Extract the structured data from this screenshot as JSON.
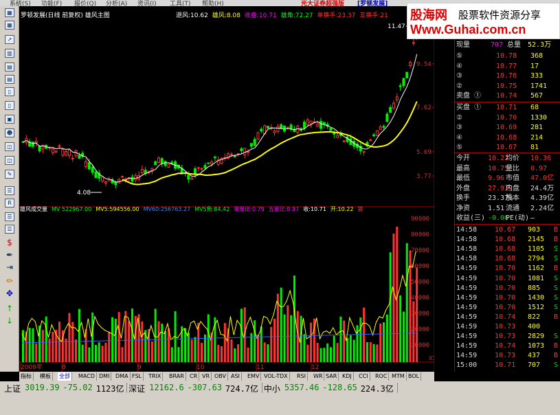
{
  "menu": {
    "items": [
      "系统(S)",
      "功能(F)",
      "报价(Q)",
      "分析(A)",
      "资讯(I)",
      "工具(T)",
      "帮助(H)"
    ],
    "brand": "光大证券超强版",
    "stock_title": "[罗顿发展]"
  },
  "toolbar_icons": [
    "grid-icon",
    "grid-icon",
    "trend-icon",
    "bar-icon",
    "table-icon",
    "table-icon",
    "doc-icon",
    "doc-icon",
    "folder-icon",
    "people-icon",
    "chart-icon",
    "chart-icon",
    "edit-icon",
    "list-icon",
    "rs-icon",
    "list-icon",
    "list-icon",
    "dollar-icon",
    "pen-icon",
    "export-icon",
    "pencil-icon",
    "crosshair-icon",
    "up-arrow-icon",
    "down-arrow-icon"
  ],
  "kline": {
    "title": "罗顿发展(日线 前复权) 雄风主图",
    "indicators": [
      {
        "label": "退风:10.62",
        "color": "#ffffff"
      },
      {
        "label": "雄风:8.08",
        "color": "#ffff00"
      },
      {
        "label": "收盘:10.71",
        "color": "#ff00ff"
      },
      {
        "label": "雄角:72.27",
        "color": "#00ff00"
      },
      {
        "label": "单换手:23.37",
        "color": "#ff3333"
      },
      {
        "label": "五换手:21",
        "color": "#ff3333"
      }
    ],
    "price_labels": [
      "9.54",
      "7.62",
      "5.69",
      "3.77"
    ],
    "high_label": "11.47",
    "low_label": "4.08"
  },
  "volume": {
    "indicators": [
      {
        "label": "雄风成交量",
        "color": "#ffffff"
      },
      {
        "label": "MV 522967.00",
        "color": "#00ff00"
      },
      {
        "label": "MV5:594556.00",
        "color": "#ffff00"
      },
      {
        "label": "MV60:256763.27",
        "color": "#4488ff"
      },
      {
        "label": "MV5角:84.42",
        "color": "#00ff00"
      },
      {
        "label": "单量比:0.79",
        "color": "#ff00ff"
      },
      {
        "label": "五量比:0.97",
        "color": "#ff00ff"
      },
      {
        "label": "收:10.71",
        "color": "#ffffff"
      },
      {
        "label": "开:10.22",
        "color": "#ffff00"
      },
      {
        "label": "震",
        "color": "#ff3333"
      }
    ],
    "axis_labels": [
      "90000",
      "80000",
      "70000",
      "60000",
      "50000",
      "40000",
      "30000",
      "20000",
      "10000"
    ],
    "unit": "X10",
    "months": [
      "2009年",
      "8",
      "9",
      "10",
      "11",
      "12"
    ]
  },
  "quote": {
    "xianliang_label": "现量",
    "xianliang": "707",
    "zongliang_label": "总量",
    "zongliang": "52.3万",
    "sells": [
      {
        "n": "⑤",
        "p": "10.78",
        "v": "368"
      },
      {
        "n": "④",
        "p": "10.77",
        "v": "17"
      },
      {
        "n": "③",
        "p": "10.76",
        "v": "333"
      },
      {
        "n": "②",
        "p": "10.75",
        "v": "1741"
      },
      {
        "n": "卖盘 ①",
        "p": "10.74",
        "v": "567"
      }
    ],
    "buys": [
      {
        "n": "买盘 ①",
        "p": "10.71",
        "v": "68"
      },
      {
        "n": "②",
        "p": "10.70",
        "v": "1330"
      },
      {
        "n": "③",
        "p": "10.69",
        "v": "281"
      },
      {
        "n": "④",
        "p": "10.68",
        "v": "214"
      },
      {
        "n": "⑤",
        "p": "10.67",
        "v": "81"
      }
    ],
    "stats": [
      {
        "l1": "今开",
        "v1": "10.22",
        "l2": "均价",
        "v2": "10.36"
      },
      {
        "l1": "最高",
        "v1": "10.75",
        "l2": "量比",
        "v2": "0.97"
      },
      {
        "l1": "最低",
        "v1": "9.96",
        "l2": "市值",
        "v2": "47.0亿"
      },
      {
        "l1": "外盘",
        "v1": "27.9万",
        "l2": "内盘",
        "v2": "24.4万"
      },
      {
        "l1": "换手",
        "v1": "23.37%",
        "l2": "股本",
        "v2": "4.39亿"
      },
      {
        "l1": "净资",
        "v1": "1.51",
        "l2": "流通",
        "v2": "2.24亿"
      },
      {
        "l1": "收益(三)",
        "v1": "-0.06",
        "l2": "PE(动)",
        "v2": "—"
      }
    ],
    "ticks": [
      {
        "t": "14:58",
        "p": "10.67",
        "v": "903",
        "d": "B"
      },
      {
        "t": "14:58",
        "p": "10.68",
        "v": "2145",
        "d": "B"
      },
      {
        "t": "14:58",
        "p": "10.68",
        "v": "1105",
        "d": "S"
      },
      {
        "t": "14:58",
        "p": "10.68",
        "v": "2794",
        "d": "S"
      },
      {
        "t": "14:59",
        "p": "10.70",
        "v": "1162",
        "d": "B"
      },
      {
        "t": "14:59",
        "p": "10.70",
        "v": "1081",
        "d": "S"
      },
      {
        "t": "14:59",
        "p": "10.70",
        "v": "885",
        "d": "S"
      },
      {
        "t": "14:59",
        "p": "10.70",
        "v": "1430",
        "d": "S"
      },
      {
        "t": "14:59",
        "p": "10.70",
        "v": "1512",
        "d": "S"
      },
      {
        "t": "14:59",
        "p": "10.74",
        "v": "822",
        "d": "B"
      },
      {
        "t": "14:59",
        "p": "10.73",
        "v": "400",
        "d": ""
      },
      {
        "t": "14:59",
        "p": "10.73",
        "v": "2829",
        "d": "S"
      },
      {
        "t": "14:59",
        "p": "10.74",
        "v": "1073",
        "d": "B"
      },
      {
        "t": "14:59",
        "p": "10.73",
        "v": "437",
        "d": "B"
      },
      {
        "t": "15:00",
        "p": "10.71",
        "v": "707",
        "d": "S"
      }
    ]
  },
  "tabs": [
    "指标",
    "模板",
    "全部",
    "MACD",
    "DMI",
    "DMA",
    "FSL",
    "TRIX",
    "BRAR",
    "CR",
    "VR",
    "OBV",
    "ASI",
    "EMV",
    "VOL-TDX",
    "RSI",
    "WR",
    "SAR",
    "KDJ",
    "CCI",
    "ROC",
    "MTM",
    "BOL"
  ],
  "status": [
    {
      "name": "上证",
      "price": "3019.39",
      "chg": "-75.02",
      "amt": "1123亿"
    },
    {
      "name": "深证",
      "price": "12162.6",
      "chg": "-307.63",
      "amt": "724.7亿"
    },
    {
      "name": "中小",
      "price": "5357.46",
      "chg": "-128.65",
      "amt": "224.3亿"
    }
  ],
  "watermark": {
    "brand": "股海网",
    "slogan": "股票软件资源分享",
    "url": "Www.Guhai.com.cn"
  },
  "colors": {
    "up": "#ff3333",
    "down": "#00ee00",
    "ma_white": "#ffffff",
    "ma_yellow": "#ffff00",
    "ma_blue": "#3366ff",
    "axis": "#aa0000"
  }
}
